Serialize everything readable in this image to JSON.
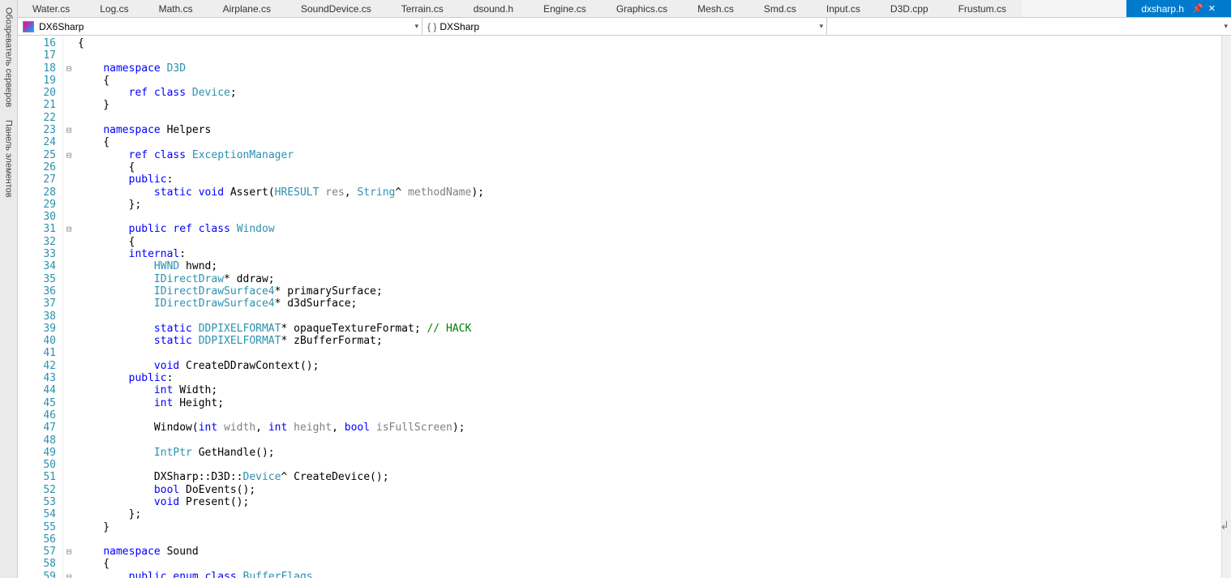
{
  "sidebar": {
    "tab1": "Обозреватель серверов",
    "tab2": "Панель элементов"
  },
  "tabs": [
    {
      "label": "Water.cs"
    },
    {
      "label": "Log.cs"
    },
    {
      "label": "Math.cs"
    },
    {
      "label": "Airplane.cs"
    },
    {
      "label": "SoundDevice.cs"
    },
    {
      "label": "Terrain.cs"
    },
    {
      "label": "dsound.h"
    },
    {
      "label": "Engine.cs"
    },
    {
      "label": "Graphics.cs"
    },
    {
      "label": "Mesh.cs"
    },
    {
      "label": "Smd.cs"
    },
    {
      "label": "Input.cs"
    },
    {
      "label": "D3D.cpp"
    },
    {
      "label": "Frustum.cs"
    },
    {
      "label": "dxsharp.h",
      "active": true
    }
  ],
  "nav": {
    "project": "DX6Sharp",
    "scope": "DXSharp"
  },
  "first_line_no": 16,
  "fold_markers": {
    "18": "-",
    "23": "-",
    "25": "-",
    "31": "-",
    "57": "-",
    "59": "-"
  },
  "code_lines": [
    {
      "n": 16,
      "html": "{"
    },
    {
      "n": 17,
      "html": ""
    },
    {
      "n": 18,
      "html": "    <span class='kw'>namespace</span> <span class='type'>D3D</span>"
    },
    {
      "n": 19,
      "html": "    {"
    },
    {
      "n": 20,
      "html": "        <span class='kw'>ref</span> <span class='kw'>class</span> <span class='type'>Device</span>;"
    },
    {
      "n": 21,
      "html": "    }"
    },
    {
      "n": 22,
      "html": ""
    },
    {
      "n": 23,
      "html": "    <span class='kw'>namespace</span> Helpers"
    },
    {
      "n": 24,
      "html": "    {"
    },
    {
      "n": 25,
      "html": "        <span class='kw'>ref</span> <span class='kw'>class</span> <span class='type'>ExceptionManager</span>"
    },
    {
      "n": 26,
      "html": "        {"
    },
    {
      "n": 27,
      "html": "        <span class='kw'>public</span>:"
    },
    {
      "n": 28,
      "html": "            <span class='kw'>static</span> <span class='kw'>void</span> Assert(<span class='type'>HRESULT</span> <span class='param'>res</span>, <span class='type'>String</span>^ <span class='param'>methodName</span>);"
    },
    {
      "n": 29,
      "html": "        };"
    },
    {
      "n": 30,
      "html": ""
    },
    {
      "n": 31,
      "html": "        <span class='kw'>public</span> <span class='kw'>ref</span> <span class='kw'>class</span> <span class='type'>Window</span>"
    },
    {
      "n": 32,
      "html": "        {"
    },
    {
      "n": 33,
      "html": "        <span class='kw'>internal</span>:"
    },
    {
      "n": 34,
      "html": "            <span class='type'>HWND</span> hwnd;"
    },
    {
      "n": 35,
      "html": "            <span class='type'>IDirectDraw</span>* ddraw;"
    },
    {
      "n": 36,
      "html": "            <span class='type'>IDirectDrawSurface4</span>* primarySurface;"
    },
    {
      "n": 37,
      "html": "            <span class='type'>IDirectDrawSurface4</span>* d3dSurface;"
    },
    {
      "n": 38,
      "html": ""
    },
    {
      "n": 39,
      "html": "            <span class='kw'>static</span> <span class='type'>DDPIXELFORMAT</span>* opaqueTextureFormat; <span class='cm'>// HACK</span>"
    },
    {
      "n": 40,
      "html": "            <span class='kw'>static</span> <span class='type'>DDPIXELFORMAT</span>* zBufferFormat;"
    },
    {
      "n": 41,
      "html": ""
    },
    {
      "n": 42,
      "html": "            <span class='kw'>void</span> CreateDDrawContext();"
    },
    {
      "n": 43,
      "html": "        <span class='kw'>public</span>:"
    },
    {
      "n": 44,
      "html": "            <span class='kw'>int</span> Width;"
    },
    {
      "n": 45,
      "html": "            <span class='kw'>int</span> Height;"
    },
    {
      "n": 46,
      "html": ""
    },
    {
      "n": 47,
      "html": "            Window(<span class='kw'>int</span> <span class='param'>width</span>, <span class='kw'>int</span> <span class='param'>height</span>, <span class='kw'>bool</span> <span class='param'>isFullScreen</span>);"
    },
    {
      "n": 48,
      "html": ""
    },
    {
      "n": 49,
      "html": "            <span class='type'>IntPtr</span> GetHandle();"
    },
    {
      "n": 50,
      "html": ""
    },
    {
      "n": 51,
      "html": "            DXSharp::D3D::<span class='type'>Device</span>^ CreateDevice();"
    },
    {
      "n": 52,
      "html": "            <span class='kw'>bool</span> DoEvents();"
    },
    {
      "n": 53,
      "html": "            <span class='kw'>void</span> Present();"
    },
    {
      "n": 54,
      "html": "        };"
    },
    {
      "n": 55,
      "html": "    }"
    },
    {
      "n": 56,
      "html": ""
    },
    {
      "n": 57,
      "html": "    <span class='kw'>namespace</span> Sound"
    },
    {
      "n": 58,
      "html": "    {"
    },
    {
      "n": 59,
      "html": "        <span class='kw'>public</span> <span class='kw'>enum</span> <span class='kw'>class</span> <span class='type'>BufferFlags</span>"
    }
  ]
}
